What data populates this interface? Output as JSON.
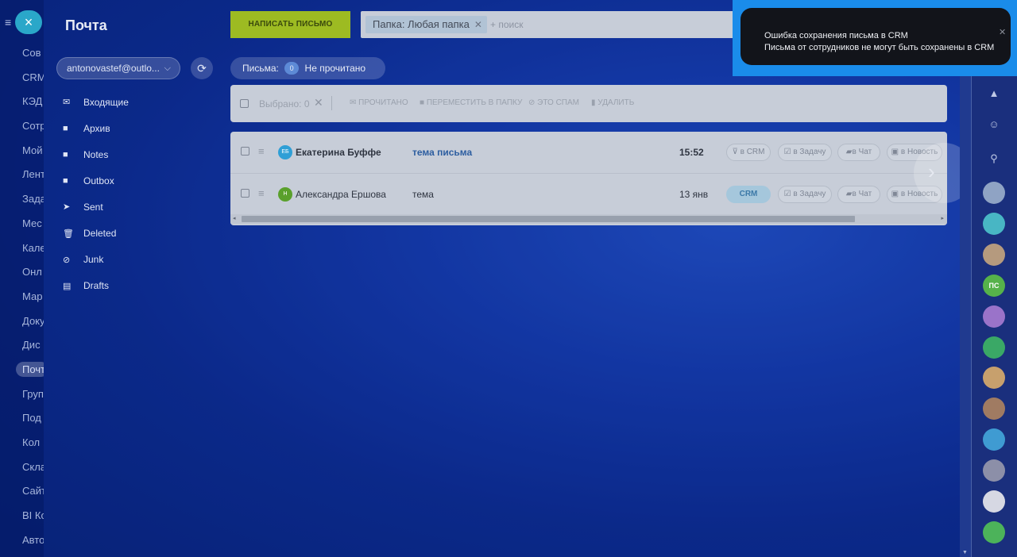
{
  "left_menu": {
    "close_glyph": "×",
    "items": [
      "Сов",
      "CRM",
      "КЭД",
      "Сотр",
      "Мой",
      "Лент",
      "Зада",
      "Мес",
      "Кале",
      "Онл",
      "Мар",
      "Доку",
      "Дис",
      "Почт",
      "Груп",
      "Под",
      "Кол",
      "Скла",
      "Сайт",
      "BI Ко",
      "Авто"
    ]
  },
  "mail": {
    "title": "Почта",
    "account": "antonovastef@outlo...",
    "folders": [
      {
        "icon": "inbox-icon",
        "glyph": "✉",
        "label": "Входящие"
      },
      {
        "icon": "folder-icon",
        "glyph": "■",
        "label": "Архив"
      },
      {
        "icon": "folder-icon",
        "glyph": "■",
        "label": "Notes"
      },
      {
        "icon": "folder-icon",
        "glyph": "■",
        "label": "Outbox"
      },
      {
        "icon": "sent-icon",
        "glyph": "➤",
        "label": "Sent"
      },
      {
        "icon": "trash-icon",
        "glyph": "🗑",
        "label": "Deleted"
      },
      {
        "icon": "junk-icon",
        "glyph": "⊘",
        "label": "Junk"
      },
      {
        "icon": "drafts-icon",
        "glyph": "▤",
        "label": "Drafts"
      }
    ],
    "compose_label": "НАПИСАТЬ ПИСЬМО",
    "search": {
      "tag": "Папка: Любая папка",
      "placeholder": "+ поиск"
    },
    "counter": {
      "label": "Письма:",
      "count": "0",
      "status": "Не прочитано"
    },
    "toolbar": {
      "selected": "Выбрано: 0",
      "read": "ПРОЧИТАНО",
      "move": "ПЕРЕМЕСТИТЬ В ПАПКУ",
      "spam": "ЭТО СПАМ",
      "delete": "УДАЛИТЬ"
    },
    "messages": [
      {
        "initials": "ЕБ",
        "avatar_color": "#2f9fd6",
        "sender": "Екатерина Буффе",
        "subject": "тема письма",
        "time": "15:52",
        "crm": "в CRM",
        "task": "в Задачу",
        "chat": "в Чат",
        "news": "в Новость"
      },
      {
        "initials": "Н",
        "avatar_color": "#5aa02c",
        "sender": "Александра Ершова",
        "subject": "тема",
        "time": "13 янв",
        "crm": "CRM",
        "task": "в Задачу",
        "chat": "в Чат",
        "news": "в Новость"
      }
    ]
  },
  "notification": {
    "title": "Ошибка сохранения письма в CRM",
    "body": "Письма от сотрудников не могут быть сохранены в CRM"
  },
  "right_bar": {
    "avatars": [
      {
        "label": "",
        "color": "#8fa3c4"
      },
      {
        "label": "",
        "color": "#48b6c4"
      },
      {
        "label": "",
        "color": "#b59a7e"
      },
      {
        "label": "ПС",
        "color": "#56b24a"
      },
      {
        "label": "",
        "color": "#9a73c9"
      },
      {
        "label": "",
        "color": "#3aa866"
      },
      {
        "label": "",
        "color": "#c7a06d"
      },
      {
        "label": "",
        "color": "#a07b62"
      },
      {
        "label": "",
        "color": "#3f9bd2"
      },
      {
        "label": "",
        "color": "#8c8fa8"
      },
      {
        "label": "",
        "color": "#d6d8e3"
      },
      {
        "label": "",
        "color": "#4cb35a"
      }
    ]
  }
}
